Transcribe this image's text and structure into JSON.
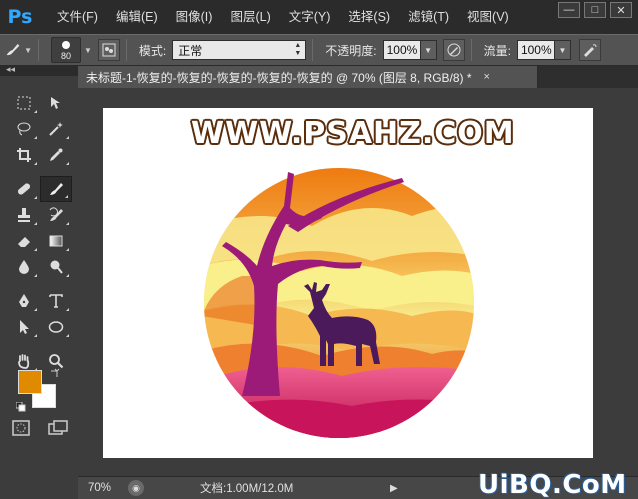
{
  "app": {
    "logo": "Ps"
  },
  "menu": [
    "文件(F)",
    "编辑(E)",
    "图像(I)",
    "图层(L)",
    "文字(Y)",
    "选择(S)",
    "滤镜(T)",
    "视图(V)"
  ],
  "window_controls": {
    "minimize": "—",
    "restore": "□",
    "close": "✕"
  },
  "options": {
    "brush_size": "80",
    "mode_label": "模式:",
    "mode_value": "正常",
    "opacity_label": "不透明度:",
    "opacity_value": "100%",
    "flow_label": "流量:",
    "flow_value": "100%"
  },
  "tab": {
    "title": "未标题-1-恢复的-恢复的-恢复的-恢复的-恢复的 @ 70% (图层 8, RGB/8) *",
    "close": "×"
  },
  "canvas": {
    "watermark": "WWW.PSAHZ.COM"
  },
  "colors": {
    "foreground": "#e08a00",
    "background": "#ffffff",
    "accent": "#31a8ff"
  },
  "status": {
    "zoom": "70%",
    "doc_info": "文档:1.00M/12.0M",
    "arrow": "▶"
  },
  "site_logo": "UiBQ.CoM",
  "tools": [
    [
      "marquee-icon",
      "move-icon"
    ],
    [
      "lasso-icon",
      "magic-wand-icon"
    ],
    [
      "crop-icon",
      "eyedropper-icon"
    ],
    [
      "healing-brush-icon",
      "brush-icon"
    ],
    [
      "clone-stamp-icon",
      "history-brush-icon"
    ],
    [
      "eraser-icon",
      "gradient-icon"
    ],
    [
      "blur-icon",
      "dodge-icon"
    ],
    [
      "pen-icon",
      "type-icon"
    ],
    [
      "path-selection-icon",
      "ellipse-shape-icon"
    ],
    [
      "hand-icon",
      "zoom-icon"
    ]
  ]
}
